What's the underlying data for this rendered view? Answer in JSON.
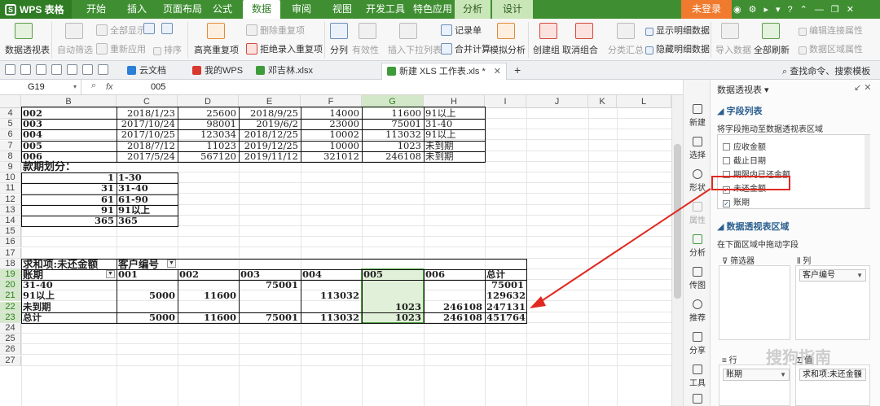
{
  "app": {
    "brand": "WPS 表格",
    "login": "未登录"
  },
  "menu_tabs": [
    "开始",
    "插入",
    "页面布局",
    "公式",
    "数据",
    "审阅",
    "视图",
    "开发工具",
    "特色应用",
    "分析",
    "设计"
  ],
  "ribbon": {
    "pivot": "数据透视表",
    "auto_filter": "自动筛选",
    "show_all": "全部显示",
    "reapply": "重新应用",
    "sort": "排序",
    "highlight_dup": "高亮重复项",
    "delete_dup": "删除重复项",
    "reject_dup": "拒绝录入重复项",
    "split": "分列",
    "validity": "有效性",
    "insert_dropdown": "插入下拉列表",
    "record_form": "记录单",
    "merge_calc": "合并计算",
    "simulate": "模拟分析",
    "create_group": "创建组",
    "ungroup": "取消组合",
    "subtotal": "分类汇总",
    "show_detail": "显示明细数据",
    "hide_detail": "隐藏明细数据",
    "import_data": "导入数据",
    "refresh_all": "全部刷新",
    "edit_conn": "编辑连接属性",
    "data_props": "数据区域属性"
  },
  "doc_tabs": [
    "云文档",
    "我的WPS",
    "邓吉林.xlsx",
    "新建 XLS 工作表.xls *"
  ],
  "find_command": "查找命令、搜索模板",
  "formula_bar": {
    "cell_ref": "G19",
    "fx": "fx",
    "value": "005"
  },
  "columns": [
    "B",
    "C",
    "D",
    "E",
    "F",
    "G",
    "H",
    "I",
    "J",
    "K",
    "L"
  ],
  "rows": [
    "4",
    "5",
    "6",
    "7",
    "8",
    "9",
    "10",
    "11",
    "12",
    "13",
    "14",
    "15",
    "16",
    "17",
    "18",
    "19",
    "20",
    "21",
    "22",
    "23",
    "24",
    "25",
    "26",
    "27"
  ],
  "data_table": [
    [
      "002",
      "2018/1/23",
      "25600",
      "2018/9/25",
      "14000",
      "11600",
      "91以上"
    ],
    [
      "003",
      "2017/10/24",
      "98001",
      "2019/6/2",
      "23000",
      "75001",
      "31-40"
    ],
    [
      "004",
      "2017/10/25",
      "123034",
      "2018/12/25",
      "10002",
      "113032",
      "91以上"
    ],
    [
      "005",
      "2018/7/12",
      "11023",
      "2019/12/25",
      "10000",
      "1023",
      "未到期"
    ],
    [
      "006",
      "2017/5/24",
      "567120",
      "2019/11/12",
      "321012",
      "246108",
      "未到期"
    ]
  ],
  "period_title": "款期划分：",
  "period_table": [
    [
      "1",
      "1-30"
    ],
    [
      "31",
      "31-40"
    ],
    [
      "61",
      "61-90"
    ],
    [
      "91",
      "91以上"
    ],
    [
      "365",
      "365"
    ]
  ],
  "pivot": {
    "value_label": "求和项:未还金额",
    "col_field": "客户编号",
    "row_field": "账期",
    "headers": [
      "001",
      "002",
      "003",
      "004",
      "005",
      "006",
      "总计"
    ],
    "rows": [
      [
        "31-40",
        "",
        "",
        "75001",
        "",
        "",
        "",
        "75001"
      ],
      [
        "91以上",
        "5000",
        "11600",
        "",
        "113032",
        "",
        "",
        "129632"
      ],
      [
        "未到期",
        "",
        "",
        "",
        "",
        "1023",
        "246108",
        "247131"
      ],
      [
        "总计",
        "5000",
        "11600",
        "75001",
        "113032",
        "1023",
        "246108",
        "451764"
      ]
    ]
  },
  "side_toolbar": [
    "新建",
    "选择",
    "形状",
    "属性",
    "分析",
    "传图",
    "推荐",
    "分享",
    "工具"
  ],
  "panel": {
    "title": "数据透视表",
    "fields_section": "字段列表",
    "fields_hint": "将字段拖动至数据透视表区域",
    "fields": [
      {
        "label": "应收金额",
        "checked": false
      },
      {
        "label": "截止日期",
        "checked": false
      },
      {
        "label": "期限内已还金额",
        "checked": false
      },
      {
        "label": "未还金额",
        "checked": true
      },
      {
        "label": "账期",
        "checked": true
      }
    ],
    "areas_section": "数据透视表区域",
    "areas_hint": "在下面区域中拖动字段",
    "filter_label": "筛选器",
    "col_label": "列",
    "row_label": "行",
    "value_label": "值",
    "col_chip": "客户编号",
    "row_chip": "账期",
    "value_chip": "求和项:未还金额"
  },
  "watermark": "搜狗指南"
}
